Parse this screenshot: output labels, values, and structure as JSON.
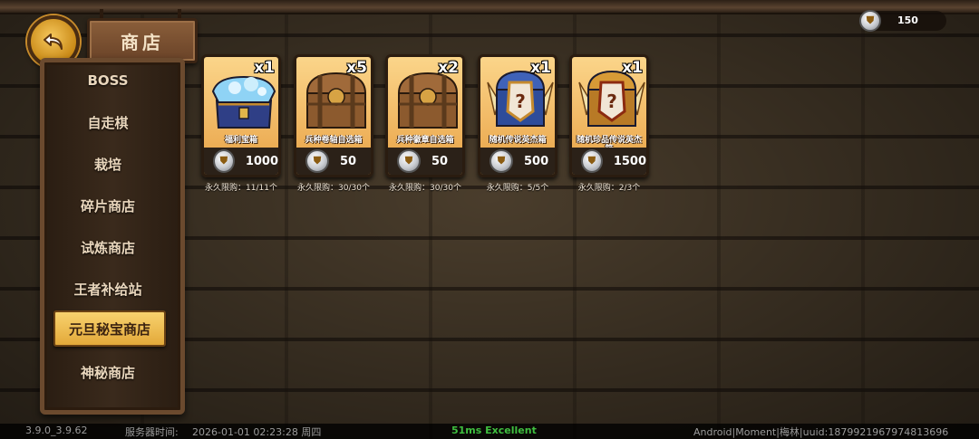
{
  "header": {
    "title": "商店",
    "currency_amount": "150"
  },
  "sidebar": {
    "items": [
      {
        "label": "BOSS",
        "active": false
      },
      {
        "label": "自走棋",
        "active": false
      },
      {
        "label": "栽培",
        "active": false
      },
      {
        "label": "碎片商店",
        "active": false
      },
      {
        "label": "试炼商店",
        "active": false
      },
      {
        "label": "王者补给站",
        "active": false
      },
      {
        "label": "元旦秘宝商店",
        "active": true
      },
      {
        "label": "神秘商店",
        "active": false
      }
    ]
  },
  "shop": {
    "items": [
      {
        "name": "福利宝箱",
        "quantity": "x1",
        "price": "1000",
        "limit": "永久限购：11/11个",
        "chest": "treasure"
      },
      {
        "name": "兵种卷轴自选箱",
        "quantity": "x5",
        "price": "50",
        "limit": "永久限购：30/30个",
        "chest": "wood"
      },
      {
        "name": "兵种徽章自选箱",
        "quantity": "x2",
        "price": "50",
        "limit": "永久限购：30/30个",
        "chest": "wood"
      },
      {
        "name": "随机传说英杰箱",
        "quantity": "x1",
        "price": "500",
        "limit": "永久限购：5/5个",
        "chest": "mystery-blue"
      },
      {
        "name": "随机珍品传说英杰箱",
        "quantity": "x1",
        "price": "1500",
        "limit": "永久限购：2/3个",
        "chest": "mystery-gold"
      }
    ]
  },
  "status": {
    "version": "3.9.0_3.9.62",
    "server_time_label": "服务器时间:",
    "server_time": "2026-01-01  02:23:28  周四",
    "ping": "51ms Excellent",
    "device": "Android|Moment|梅林|uuid:1879921967974813696"
  },
  "colors": {
    "accent": "#f2c25a",
    "ping": "#3fbf3f",
    "card": "#eeb15a"
  }
}
